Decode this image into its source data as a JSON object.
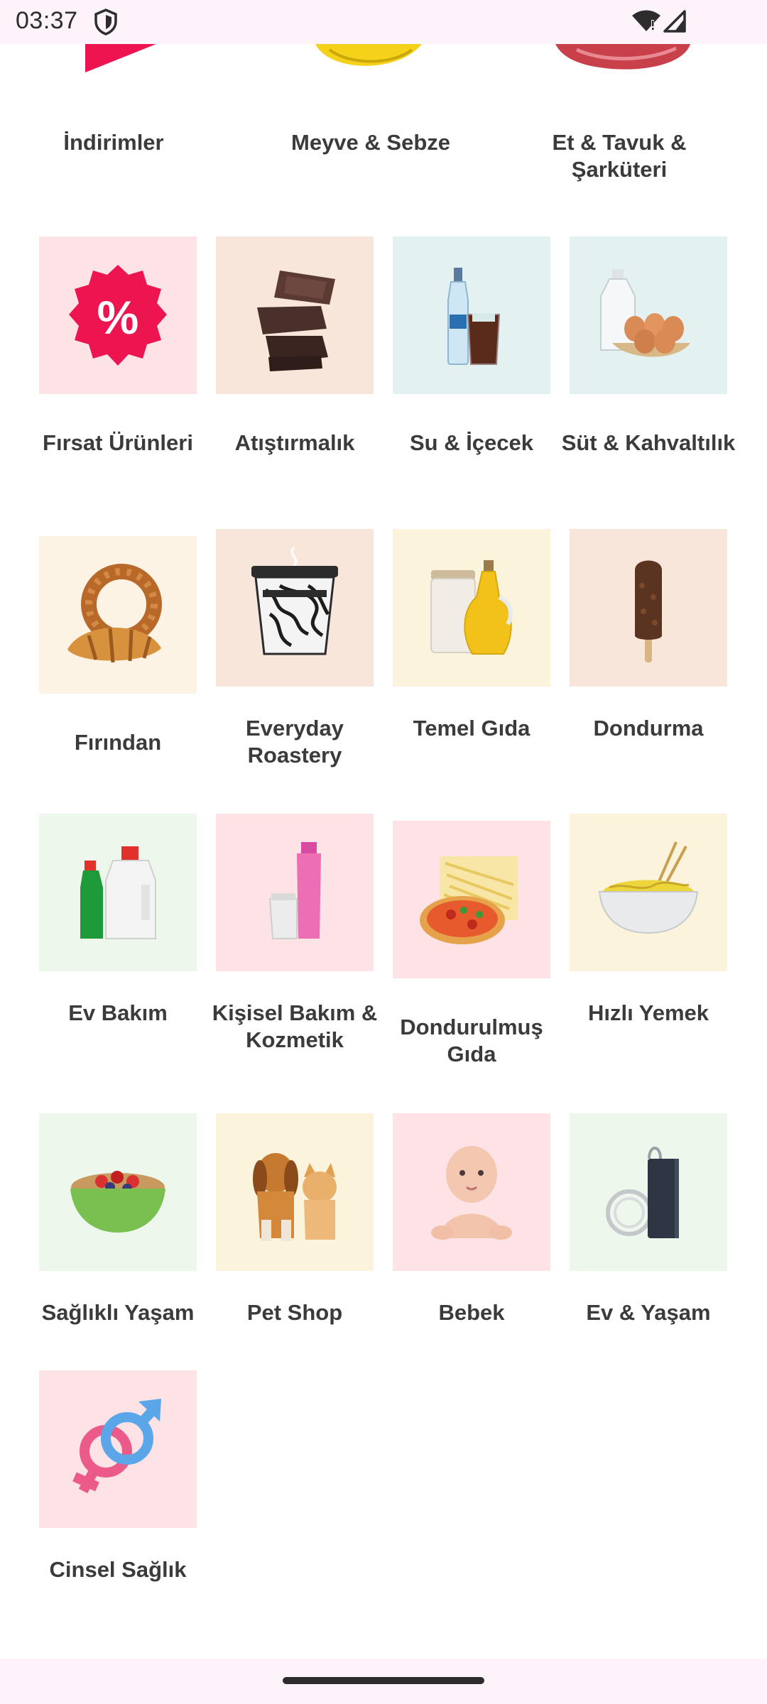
{
  "status_bar": {
    "time": "03:37"
  },
  "top_row": [
    {
      "name": "İndirimler"
    },
    {
      "name": "Meyve & Sebze"
    },
    {
      "name": "Et & Tavuk & Şarküteri"
    }
  ],
  "categories": [
    {
      "name": "Fırsat Ürünleri",
      "bg": "#fde3e6"
    },
    {
      "name": "Atıştırmalık",
      "bg": "#f8e6da"
    },
    {
      "name": "Su & İçecek",
      "bg": "#e4f1f1"
    },
    {
      "name": "Süt & Kahvaltılık",
      "bg": "#e4f1f1"
    },
    {
      "name": "Fırından",
      "bg": "#fdf3e4"
    },
    {
      "name": "Everyday Roastery",
      "bg": "#f8e6da"
    },
    {
      "name": "Temel Gıda",
      "bg": "#fbf3dc"
    },
    {
      "name": "Dondurma",
      "bg": "#f8e6da"
    },
    {
      "name": "Ev Bakım",
      "bg": "#eef7ec"
    },
    {
      "name": "Kişisel Bakım & Kozmetik",
      "bg": "#fde3e6"
    },
    {
      "name": "Dondurulmuş Gıda",
      "bg": "#fde3e6"
    },
    {
      "name": "Hızlı Yemek",
      "bg": "#fbf3dc"
    },
    {
      "name": "Sağlıklı Yaşam",
      "bg": "#eef7ec"
    },
    {
      "name": "Pet Shop",
      "bg": "#fbf3dc"
    },
    {
      "name": "Bebek",
      "bg": "#fde3e6"
    },
    {
      "name": "Ev & Yaşam",
      "bg": "#eef7ec"
    },
    {
      "name": "Cinsel Sağlık",
      "bg": "#fde3e6"
    }
  ]
}
